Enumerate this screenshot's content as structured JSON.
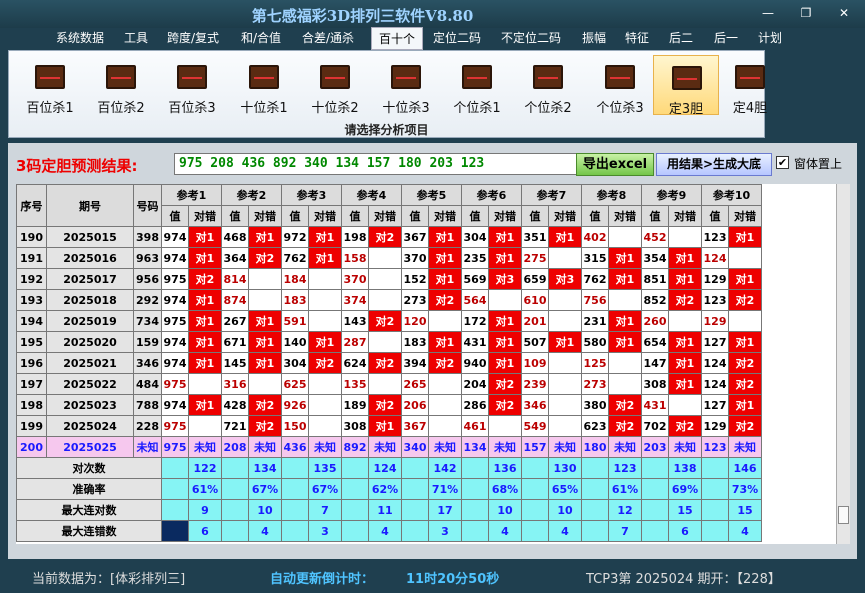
{
  "window": {
    "title": "第七感福彩3D排列三软件V8.80",
    "min": "—",
    "restore": "❐",
    "close": "✕"
  },
  "menu": [
    "系统数据",
    "工具",
    "跨度/复式",
    "和/合值",
    "合差/通杀",
    "百十个",
    "定位二码",
    "不定位二码",
    "振幅",
    "特征",
    "后二",
    "后一",
    "计划"
  ],
  "menu_active": 5,
  "ribbon": {
    "buttons": [
      "百位杀1",
      "百位杀2",
      "百位杀3",
      "十位杀1",
      "十位杀2",
      "十位杀3",
      "个位杀1",
      "个位杀2",
      "个位杀3",
      "定3胆",
      "定4胆"
    ],
    "selected": 9,
    "caption": "请选择分析项目"
  },
  "prediction": {
    "label": "3码定胆预测结果:",
    "value": "975 208 436 892 340 134 157 180 203 123",
    "excel_button": "导出excel",
    "gen_button": "用结果>生成大底",
    "pin_label": "窗体置上",
    "pin_checked": "✔"
  },
  "table": {
    "headers": {
      "seq": "序号",
      "period": "期号",
      "code": "号码",
      "refs": [
        "参考1",
        "参考2",
        "参考3",
        "参考4",
        "参考5",
        "参考6",
        "参考7",
        "参考8",
        "参考9",
        "参考10"
      ],
      "val": "值",
      "hit": "对错"
    },
    "rows": [
      {
        "seq": "190",
        "period": "2025015",
        "code": "398",
        "cells": [
          [
            "974",
            "对1"
          ],
          [
            "468",
            "对1"
          ],
          [
            "972",
            "对1"
          ],
          [
            "198",
            "对2"
          ],
          [
            "367",
            "对1"
          ],
          [
            "304",
            "对1"
          ],
          [
            "351",
            "对1"
          ],
          [
            "402",
            ""
          ],
          [
            "452",
            ""
          ],
          [
            "123",
            "对1"
          ]
        ]
      },
      {
        "seq": "191",
        "period": "2025016",
        "code": "963",
        "cells": [
          [
            "974",
            "对1"
          ],
          [
            "364",
            "对2"
          ],
          [
            "762",
            "对1"
          ],
          [
            "158",
            ""
          ],
          [
            "370",
            "对1"
          ],
          [
            "235",
            "对1"
          ],
          [
            "275",
            ""
          ],
          [
            "315",
            "对1"
          ],
          [
            "354",
            "对1"
          ],
          [
            "124",
            ""
          ]
        ]
      },
      {
        "seq": "192",
        "period": "2025017",
        "code": "956",
        "cells": [
          [
            "975",
            "对2"
          ],
          [
            "814",
            ""
          ],
          [
            "184",
            ""
          ],
          [
            "370",
            ""
          ],
          [
            "152",
            "对1"
          ],
          [
            "569",
            "对3"
          ],
          [
            "659",
            "对3"
          ],
          [
            "762",
            "对1"
          ],
          [
            "851",
            "对1"
          ],
          [
            "129",
            "对1"
          ]
        ]
      },
      {
        "seq": "193",
        "period": "2025018",
        "code": "292",
        "cells": [
          [
            "974",
            "对1"
          ],
          [
            "874",
            ""
          ],
          [
            "183",
            ""
          ],
          [
            "374",
            ""
          ],
          [
            "273",
            "对2"
          ],
          [
            "564",
            ""
          ],
          [
            "610",
            ""
          ],
          [
            "756",
            ""
          ],
          [
            "852",
            "对2"
          ],
          [
            "123",
            "对2"
          ]
        ]
      },
      {
        "seq": "194",
        "period": "2025019",
        "code": "734",
        "cells": [
          [
            "975",
            "对1"
          ],
          [
            "267",
            "对1"
          ],
          [
            "591",
            ""
          ],
          [
            "143",
            "对2"
          ],
          [
            "120",
            ""
          ],
          [
            "172",
            "对1"
          ],
          [
            "201",
            ""
          ],
          [
            "231",
            "对1"
          ],
          [
            "260",
            ""
          ],
          [
            "129",
            ""
          ]
        ]
      },
      {
        "seq": "195",
        "period": "2025020",
        "code": "159",
        "cells": [
          [
            "974",
            "对1"
          ],
          [
            "671",
            "对1"
          ],
          [
            "140",
            "对1"
          ],
          [
            "287",
            ""
          ],
          [
            "183",
            "对1"
          ],
          [
            "431",
            "对1"
          ],
          [
            "507",
            "对1"
          ],
          [
            "580",
            "对1"
          ],
          [
            "654",
            "对1"
          ],
          [
            "127",
            "对1"
          ]
        ]
      },
      {
        "seq": "196",
        "period": "2025021",
        "code": "346",
        "cells": [
          [
            "974",
            "对1"
          ],
          [
            "145",
            "对1"
          ],
          [
            "304",
            "对2"
          ],
          [
            "624",
            "对2"
          ],
          [
            "394",
            "对2"
          ],
          [
            "940",
            "对1"
          ],
          [
            "109",
            ""
          ],
          [
            "125",
            ""
          ],
          [
            "147",
            "对1"
          ],
          [
            "124",
            "对2"
          ]
        ]
      },
      {
        "seq": "197",
        "period": "2025022",
        "code": "484",
        "cells": [
          [
            "975",
            ""
          ],
          [
            "316",
            ""
          ],
          [
            "625",
            ""
          ],
          [
            "135",
            ""
          ],
          [
            "265",
            ""
          ],
          [
            "204",
            "对2"
          ],
          [
            "239",
            ""
          ],
          [
            "273",
            ""
          ],
          [
            "308",
            "对1"
          ],
          [
            "124",
            "对2"
          ]
        ]
      },
      {
        "seq": "198",
        "period": "2025023",
        "code": "788",
        "cells": [
          [
            "974",
            "对1"
          ],
          [
            "428",
            "对2"
          ],
          [
            "926",
            ""
          ],
          [
            "189",
            "对2"
          ],
          [
            "206",
            ""
          ],
          [
            "286",
            "对2"
          ],
          [
            "346",
            ""
          ],
          [
            "380",
            "对2"
          ],
          [
            "431",
            ""
          ],
          [
            "127",
            "对1"
          ]
        ]
      },
      {
        "seq": "199",
        "period": "2025024",
        "code": "228",
        "cells": [
          [
            "975",
            ""
          ],
          [
            "721",
            "对2"
          ],
          [
            "150",
            ""
          ],
          [
            "308",
            "对1"
          ],
          [
            "367",
            ""
          ],
          [
            "461",
            ""
          ],
          [
            "549",
            ""
          ],
          [
            "623",
            "对2"
          ],
          [
            "702",
            "对2"
          ],
          [
            "129",
            "对2"
          ]
        ]
      }
    ],
    "pred_row": {
      "seq": "200",
      "period": "2025025",
      "code": "未知",
      "cells": [
        [
          "975",
          "未知"
        ],
        [
          "208",
          "未知"
        ],
        [
          "436",
          "未知"
        ],
        [
          "892",
          "未知"
        ],
        [
          "340",
          "未知"
        ],
        [
          "134",
          "未知"
        ],
        [
          "157",
          "未知"
        ],
        [
          "180",
          "未知"
        ],
        [
          "203",
          "未知"
        ],
        [
          "123",
          "未知"
        ]
      ]
    },
    "stats": [
      {
        "label": "对次数",
        "values": [
          "122",
          "134",
          "135",
          "124",
          "142",
          "136",
          "130",
          "123",
          "138",
          "146"
        ]
      },
      {
        "label": "准确率",
        "values": [
          "61%",
          "67%",
          "67%",
          "62%",
          "71%",
          "68%",
          "65%",
          "61%",
          "69%",
          "73%"
        ]
      },
      {
        "label": "最大连对数",
        "values": [
          "9",
          "10",
          "7",
          "11",
          "17",
          "10",
          "10",
          "12",
          "15",
          "15"
        ]
      },
      {
        "label": "最大连错数",
        "values": [
          "6",
          "4",
          "3",
          "4",
          "3",
          "4",
          "4",
          "7",
          "6",
          "4"
        ]
      }
    ]
  },
  "status": {
    "current": "当前数据为：[体彩排列三]",
    "countdown_label": "自动更新倒计时：",
    "countdown": "11时20分50秒",
    "draw": "TCP3第 2025024 期开：【228】"
  }
}
